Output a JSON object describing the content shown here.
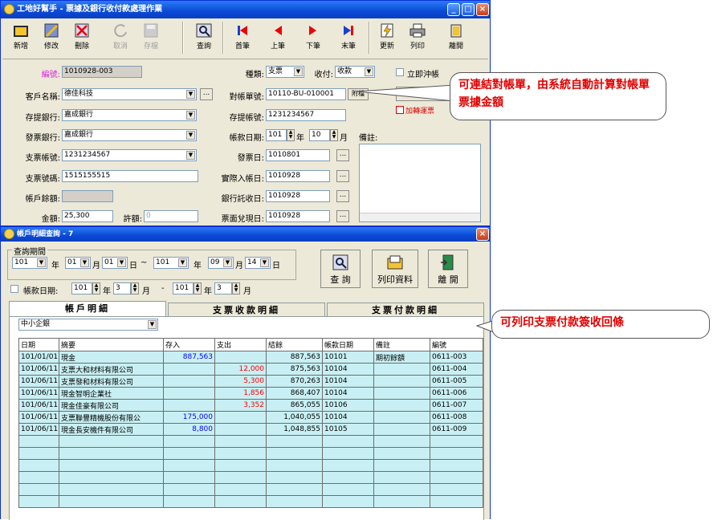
{
  "window1": {
    "title": "工地好幫手 - 票據及銀行收付款處理作業",
    "toolbar": {
      "add": "新增",
      "edit": "修改",
      "delete": "刪除",
      "cancel": "取消",
      "save": "存檔",
      "query": "查詢",
      "first": "首筆",
      "prev": "上筆",
      "next": "下筆",
      "last": "末筆",
      "update": "更新",
      "print": "列印",
      "exit": "離開"
    },
    "form": {
      "id_label": "編號:",
      "id_value": "1010928-003",
      "type_label": "種類:",
      "type_value": "支票",
      "pay_label": "收付:",
      "pay_value": "收款",
      "immediate_label": "立即沖帳",
      "customer_label": "客戶名稱:",
      "customer_value": "德佳科技",
      "statement_label": "對帳單號:",
      "statement_value": "10110-BU-010001",
      "attach_label": "附檔",
      "cash_label": "兌現(入帳)",
      "transfer_label": "加轉運票",
      "deposit_bank_label": "存提銀行:",
      "deposit_bank_value": "嘉成銀行",
      "deposit_acct_label": "存提帳號:",
      "deposit_acct_value": "1231234567",
      "issue_bank_label": "發票銀行:",
      "issue_bank_value": "嘉成銀行",
      "period_label": "帳款日期:",
      "period_year": "101",
      "period_year_unit": "年",
      "period_month": "10",
      "period_month_unit": "月",
      "remark_label": "備註:",
      "check_acct_label": "支票帳號:",
      "check_acct_value": "1231234567",
      "issue_date_label": "發票日:",
      "issue_date_value": "1010801",
      "check_no_label": "支票號碼:",
      "check_no_value": "1515155515",
      "actual_date_label": "實際入帳日:",
      "actual_date_value": "1010928",
      "account_label": "帳戶餘額:",
      "collect_date_label": "銀行託收日:",
      "collect_date_value": "1010928",
      "amount_label": "金額:",
      "amount_value": "25,300",
      "discount_label": "許額:",
      "discount_value": "0",
      "face_date_label": "票面兌現日:",
      "face_date_value": "1010928"
    }
  },
  "callout1": "可連結對帳單，由系統自動計算對帳單票據金額",
  "callout2": "可列印支票付款簽收回條",
  "window2": {
    "title": "帳戶明細查詢 - 7",
    "period_label": "查詢期間",
    "from_year": "101",
    "from_month": "01",
    "from_day": "01",
    "to_year": "101",
    "to_month": "09",
    "to_day": "14",
    "year_u": "年",
    "month_u": "月",
    "day_u": "日",
    "tilde": "~",
    "dash": "-",
    "acct_date_label": "帳款日期:",
    "ad_year1": "101",
    "ad_month1": "3",
    "ad_year2": "101",
    "ad_month2": "3",
    "btn_query": "查 詢",
    "btn_print": "列印資料",
    "btn_exit": "離 開",
    "tabs": [
      "帳戶明細",
      "支票收款明細",
      "支票付款明細"
    ],
    "bank_select": "中小企銀",
    "columns": [
      "日期",
      "摘要",
      "存入",
      "支出",
      "結餘",
      "帳款日期",
      "備註",
      "編號"
    ],
    "rows": [
      [
        "101/01/01",
        "現金",
        "887,563",
        "",
        "887,563",
        "10101",
        "期初餘額",
        "0611-003"
      ],
      [
        "101/06/11",
        "支票大和材料有限公司",
        "",
        "12,000",
        "875,563",
        "10104",
        "",
        "0611-004"
      ],
      [
        "101/06/11",
        "支票發和材料有限公司",
        "",
        "5,300",
        "870,263",
        "10104",
        "",
        "0611-005"
      ],
      [
        "101/06/11",
        "現金智明企業社",
        "",
        "1,856",
        "868,407",
        "10104",
        "",
        "0611-006"
      ],
      [
        "101/06/11",
        "現金佳豪有限公司",
        "",
        "3,352",
        "865,055",
        "10106",
        "",
        "0611-007"
      ],
      [
        "101/06/11",
        "支票聯豐精機股份有限公",
        "175,000",
        "",
        "1,040,055",
        "10104",
        "",
        "0611-008"
      ],
      [
        "101/06/11",
        "現金長安機件有限公司",
        "8,800",
        "",
        "1,048,855",
        "10105",
        "",
        "0611-009"
      ]
    ],
    "empty_rows": 6
  }
}
